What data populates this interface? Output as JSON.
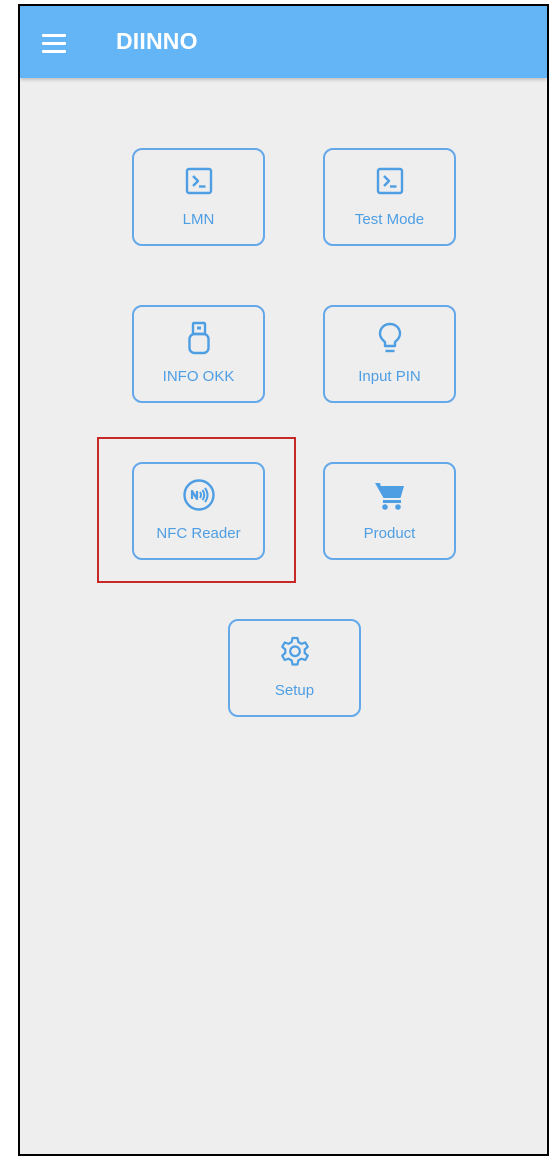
{
  "appbar": {
    "title": "DIINNO",
    "menu_icon": "hamburger-menu-icon",
    "background": "#64b5f6"
  },
  "colors": {
    "accent": "#4e9ee4",
    "background": "#eeeeee",
    "highlight": "#c62828"
  },
  "tiles": [
    {
      "label": "LMN",
      "icon": "terminal-icon"
    },
    {
      "label": "Test Mode",
      "icon": "terminal-icon"
    },
    {
      "label": "INFO OKK",
      "icon": "usb-drive-icon"
    },
    {
      "label": "Input PIN",
      "icon": "lightbulb-icon"
    },
    {
      "label": "NFC Reader",
      "icon": "nfc-icon"
    },
    {
      "label": "Product",
      "icon": "cart-icon"
    },
    {
      "label": "Setup",
      "icon": "gear-icon"
    }
  ]
}
